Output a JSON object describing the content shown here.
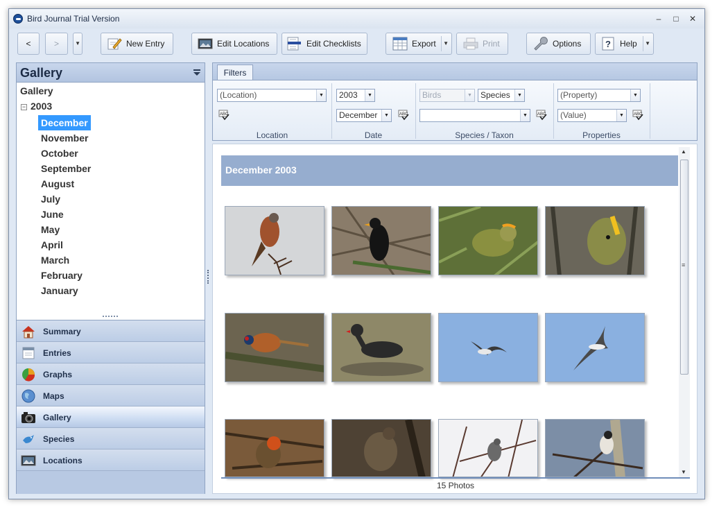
{
  "window": {
    "title": "Bird Journal Trial Version"
  },
  "toolbar": {
    "back": "<",
    "forward": ">",
    "new_entry": "New Entry",
    "edit_locations": "Edit Locations",
    "edit_checklists": "Edit Checklists",
    "export": "Export",
    "print": "Print",
    "options": "Options",
    "help": "Help"
  },
  "sidebar": {
    "header": "Gallery",
    "tree_root": "Gallery",
    "year": "2003",
    "months": [
      "December",
      "November",
      "October",
      "September",
      "August",
      "July",
      "June",
      "May",
      "April",
      "March",
      "February",
      "January"
    ],
    "selected_month": "December"
  },
  "nav": {
    "items": [
      "Summary",
      "Entries",
      "Graphs",
      "Maps",
      "Gallery",
      "Species",
      "Locations"
    ],
    "active": "Gallery"
  },
  "filters": {
    "tab": "Filters",
    "location": {
      "value": "(Location)",
      "label": "Location"
    },
    "date": {
      "year": "2003",
      "month": "December",
      "label": "Date"
    },
    "species": {
      "group": "Birds",
      "level": "Species",
      "value": "",
      "label": "Species / Taxon"
    },
    "properties": {
      "property": "(Property)",
      "value": "(Value)",
      "label": "Properties"
    }
  },
  "gallery": {
    "banner": "December 2003",
    "photos": [
      "kestrel",
      "blackbird",
      "goldcrest",
      "goldcrest-close",
      "pheasant",
      "moorhen",
      "gull-flying",
      "gull-gliding",
      "robin",
      "song-thrush",
      "fieldfare",
      "long-tailed-tit"
    ],
    "status": "15 Photos"
  }
}
